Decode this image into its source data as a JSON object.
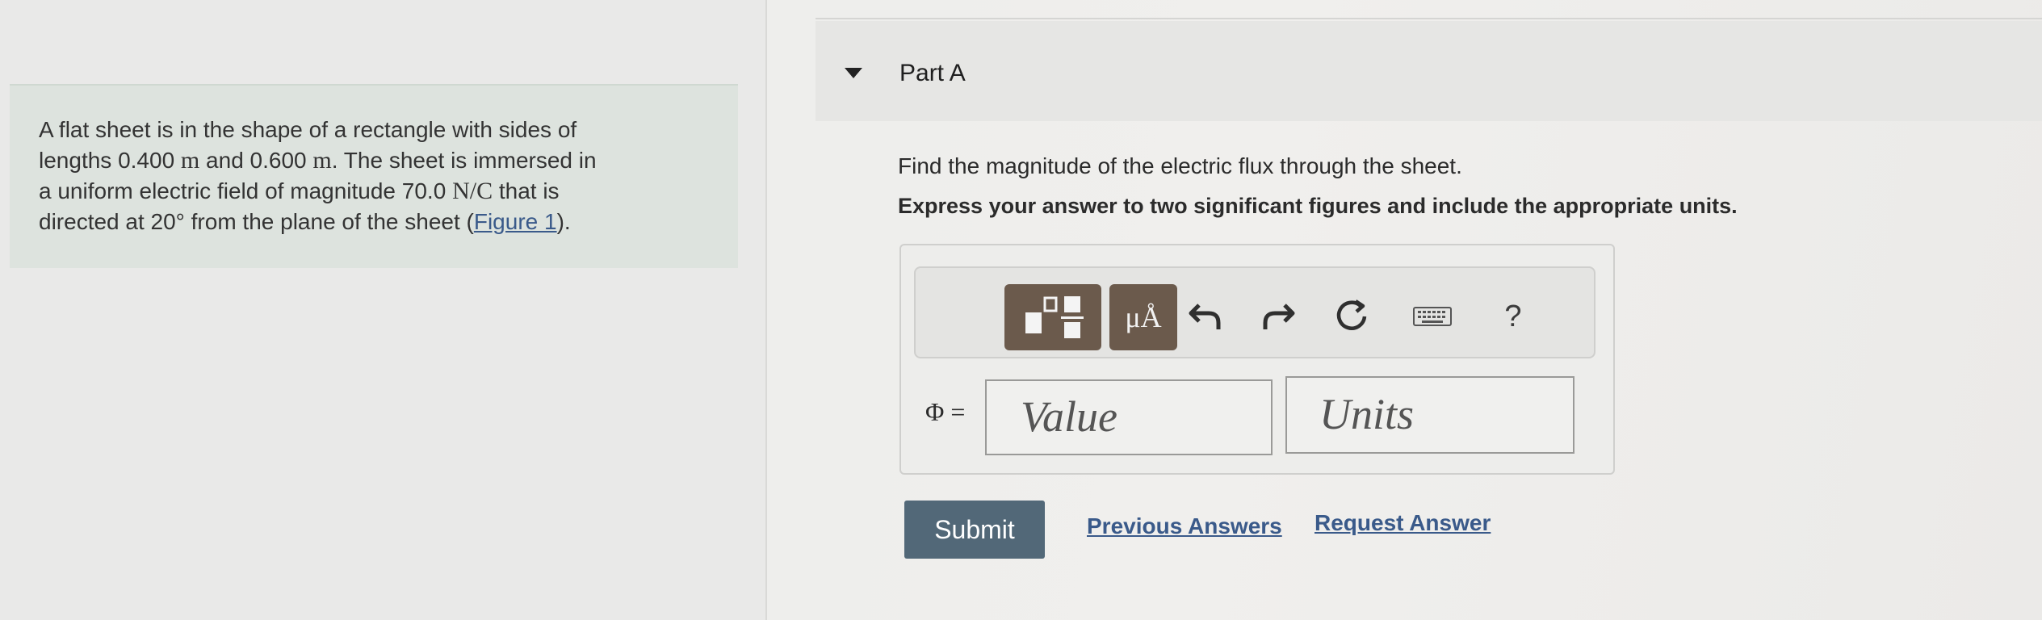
{
  "problem": {
    "text_1": "A flat sheet is in the shape of a rectangle with sides of",
    "text_2a": "lengths 0.400 ",
    "unit_m1": "m",
    "text_2b": " and 0.600 ",
    "unit_m2": "m",
    "text_2c": ". The sheet is immersed in",
    "text_3a": "a uniform electric field of magnitude 70.0 ",
    "unit_nc": "N/C",
    "text_3b": " that is",
    "text_4a": "directed at 20° from the plane of the sheet (",
    "figure_link": "Figure 1",
    "text_4b": ")."
  },
  "part": {
    "title": "Part A",
    "question": "Find the magnitude of the electric flux through the sheet.",
    "instructions": "Express your answer to two significant figures and include the appropriate units."
  },
  "toolbar": {
    "units_label": "μÅ",
    "help_label": "?"
  },
  "answer": {
    "variable_label": "Φ =",
    "value_placeholder": "Value",
    "units_placeholder": "Units"
  },
  "actions": {
    "submit_label": "Submit",
    "previous_answers_label": "Previous Answers",
    "request_answer_label": "Request Answer"
  }
}
